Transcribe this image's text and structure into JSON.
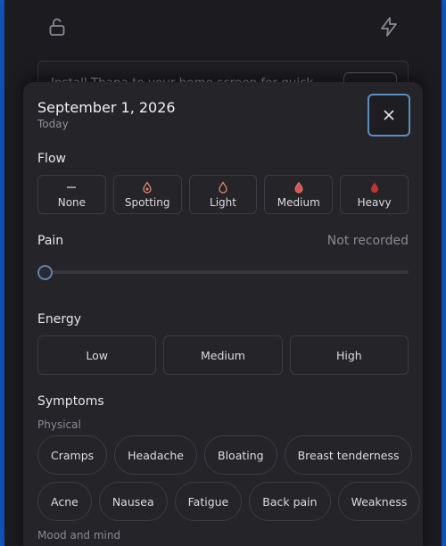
{
  "colors": {
    "accent": "#5b8fc4",
    "flow_red": "#d9544b",
    "flow_pink": "#e07a72",
    "flow_outline": "#e08870"
  },
  "topbar": {
    "left_icon": "unlock-icon",
    "right_icon": "lightning-icon"
  },
  "banner": {
    "text": "Install Thapa to your home screen for quick"
  },
  "sheet": {
    "date": "September 1, 2026",
    "subtitle": "Today",
    "close_icon": "close-icon",
    "flow": {
      "label": "Flow",
      "options": [
        {
          "label": "None",
          "icon": "dash-icon"
        },
        {
          "label": "Spotting",
          "icon": "drop-dot-icon"
        },
        {
          "label": "Light",
          "icon": "drop-outline-icon"
        },
        {
          "label": "Medium",
          "icon": "drop-half-icon"
        },
        {
          "label": "Heavy",
          "icon": "drop-filled-icon"
        }
      ]
    },
    "pain": {
      "label": "Pain",
      "status": "Not recorded",
      "level": 0
    },
    "energy": {
      "label": "Energy",
      "options": [
        "Low",
        "Medium",
        "High"
      ]
    },
    "symptoms": {
      "label": "Symptoms",
      "physical_label": "Physical",
      "physical": [
        "Cramps",
        "Headache",
        "Bloating",
        "Breast tenderness",
        "Acne",
        "Nausea",
        "Fatigue",
        "Back pain",
        "Weakness"
      ],
      "mood_label": "Mood and mind"
    }
  }
}
